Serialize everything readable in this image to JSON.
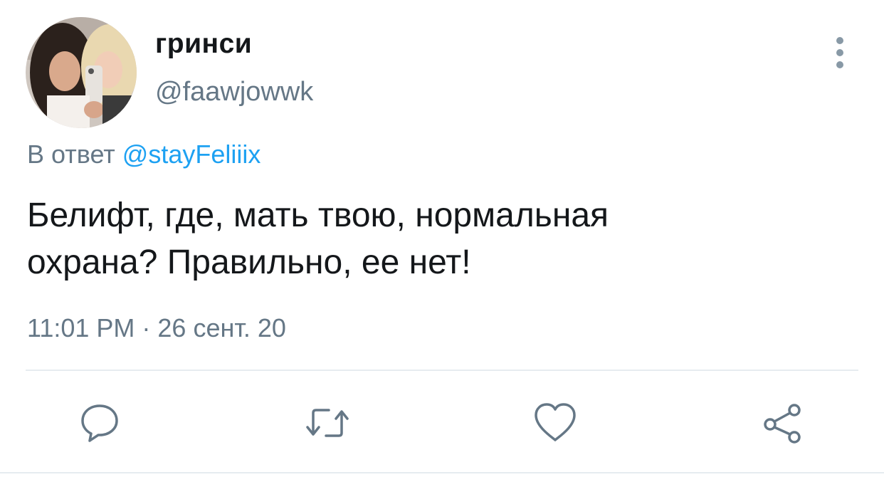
{
  "user": {
    "display_name": "гринси",
    "handle": "@faawjowwk",
    "avatar_icon": "avatar-photo"
  },
  "reply": {
    "prefix": "В ответ",
    "mention": "@stayFeliiix"
  },
  "tweet": {
    "text_line1": "Белифт, где, мать твою, нормальная",
    "text_line2": "охрана? Правильно, ее нет!",
    "timestamp": "11:01 PM · 26 сент. 20"
  },
  "actions": {
    "reply_icon": "reply-icon",
    "retweet_icon": "retweet-icon",
    "like_icon": "heart-icon",
    "share_icon": "share-icon",
    "more_icon": "more-vertical-icon"
  },
  "colors": {
    "text": "#14171a",
    "secondary": "#657786",
    "link": "#1da1f2",
    "icon": "#657786",
    "divider": "#e6ecf0"
  }
}
